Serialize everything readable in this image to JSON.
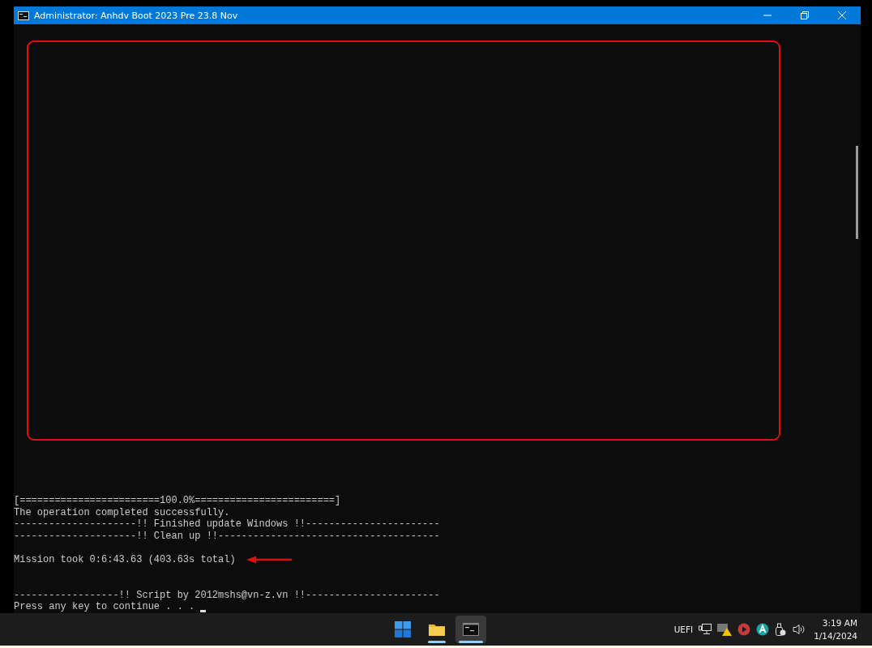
{
  "window": {
    "title": "Administrator:  Anhdv Boot 2023 Pre 23.8 Nov"
  },
  "console": {
    "blocks": [
      [
        {
          "text": "[========================100.0%========================]",
          "annotated": false,
          "cursor": false
        },
        {
          "text": "The operation completed successfully.",
          "annotated": false,
          "cursor": false
        },
        {
          "text": "---------------------!! Finished update Windows !!-----------------------",
          "annotated": false,
          "cursor": false
        },
        {
          "text": "---------------------!! Clean up !!--------------------------------------",
          "annotated": false,
          "cursor": false
        }
      ],
      [
        {
          "text": "Mission took 0:6:43.63 (403.63s total)",
          "annotated": true,
          "cursor": false
        }
      ],
      [
        {
          "text": "------------------!! Script by 2012mshs@vn-z.vn !!-----------------------",
          "annotated": false,
          "cursor": false
        },
        {
          "text": "Press any key to continue . . . ",
          "annotated": false,
          "cursor": true
        }
      ]
    ]
  },
  "taskbar": {
    "apps": [
      {
        "kind": "start",
        "running": false,
        "selected": false
      },
      {
        "kind": "folder",
        "running": true,
        "selected": false
      },
      {
        "kind": "terminal",
        "running": true,
        "selected": true
      }
    ],
    "tray": {
      "label": "UEFI",
      "time": "3:19 AM",
      "date": "1/14/2024"
    }
  }
}
